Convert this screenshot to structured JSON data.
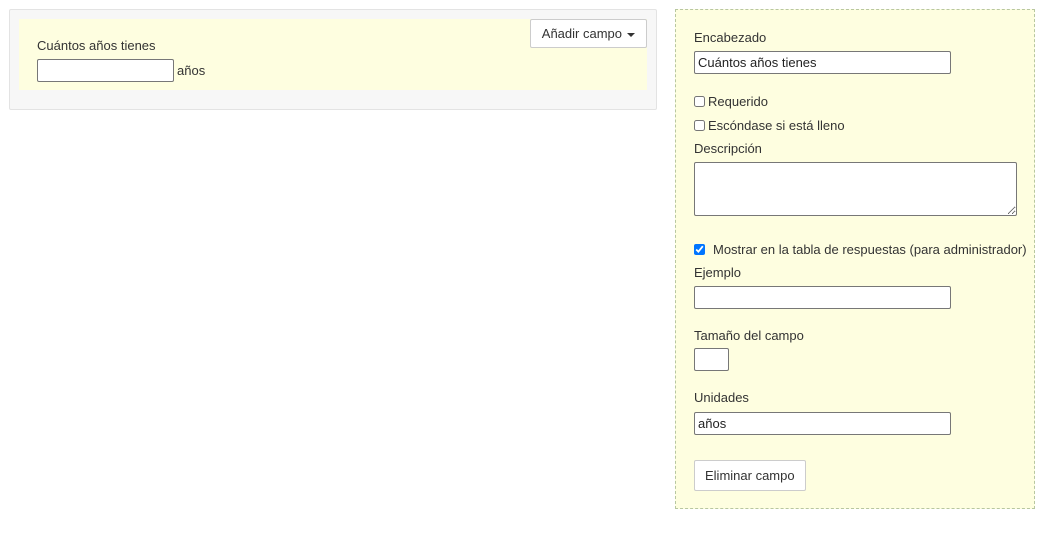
{
  "preview": {
    "add_field_label": "Añadir campo",
    "field_label": "Cuántos años tienes",
    "field_value": "",
    "units": "años"
  },
  "editor": {
    "heading_label": "Encabezado",
    "heading_value": "Cuántos años tienes",
    "required_label": "Requerido",
    "required_checked": false,
    "hide_if_filled_label": "Escóndase si está lleno",
    "hide_if_filled_checked": false,
    "description_label": "Descripción",
    "description_value": "",
    "show_in_table_label": "Mostrar en la tabla de respuestas (para administrador)",
    "show_in_table_checked": true,
    "example_label": "Ejemplo",
    "example_value": "",
    "field_size_label": "Tamaño del campo",
    "field_size_value": "",
    "units_label": "Unidades",
    "units_value": "años",
    "delete_label": "Eliminar campo"
  }
}
